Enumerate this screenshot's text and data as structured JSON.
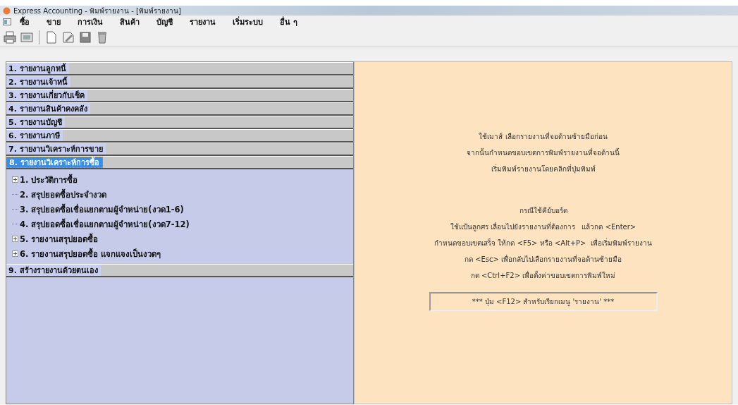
{
  "window": {
    "title": "Express Accounting - พิมพ์รายงาน - [พิมพ์รายงาน]"
  },
  "menu": [
    "ซื้อ",
    "ขาย",
    "การเงิน",
    "สินค้า",
    "บัญชี",
    "รายงาน",
    "เริ่มระบบ",
    "อื่น ๆ"
  ],
  "toolbar": [
    {
      "kind": "printer"
    },
    {
      "kind": "preview"
    },
    {
      "kind": "sep"
    },
    {
      "kind": "page"
    },
    {
      "kind": "edit"
    },
    {
      "kind": "save"
    },
    {
      "kind": "trash"
    }
  ],
  "categories": [
    {
      "label": "1. รายงานลูกหนี้",
      "selected": false
    },
    {
      "label": "2. รายงานเจ้าหนี้",
      "selected": false
    },
    {
      "label": "3. รายงานเกี่ยวกับเช็ค",
      "selected": false
    },
    {
      "label": "4. รายงานสินค้าคงคลัง",
      "selected": false
    },
    {
      "label": "5. รายงานบัญชี",
      "selected": false
    },
    {
      "label": "6. รายงานภาษี",
      "selected": false
    },
    {
      "label": "7. รายงานวิเคราะห์การขาย",
      "selected": false
    },
    {
      "label": "8. รายงานวิเคราะห์การซื้อ",
      "selected": true,
      "children": [
        {
          "label": "1. ประวัติการซื้อ",
          "expandable": true
        },
        {
          "label": "2. สรุปยอดซื้อประจำงวด",
          "expandable": false
        },
        {
          "label": "3. สรุปยอดซื้อเชื่อแยกตามผู้จำหน่าย(งวด1-6)",
          "expandable": false
        },
        {
          "label": "4. สรุปยอดซื้อเชื่อแยกตามผู้จำหน่าย(งวด7-12)",
          "expandable": false
        },
        {
          "label": "5. รายงานสรุปยอดซื้อ",
          "expandable": true
        },
        {
          "label": "6. รายงานสรุปยอดซื้อ แจกแจงเป็นงวดๆ",
          "expandable": true
        }
      ]
    },
    {
      "label": "9. สร้างรายงานด้วยตนเอง",
      "selected": false
    }
  ],
  "instructions": {
    "mouse": [
      "ใช้เมาส์ เลือกรายงานที่จอด้านซ้ายมือก่อน",
      "จากนั้นกำหนดขอบเขตการพิมพ์รายงานที่จอด้านนี้",
      "เริ่มพิมพ์รายงานโดยคลิกที่ปุ่มพิมพ์"
    ],
    "keyboard_title": "กรณีใช้คีย์บอร์ด",
    "keyboard": [
      "ใช้แป้นลูกศร เลื่อนไปยังรายงานที่ต้องการ   แล้วกด <Enter>",
      "กำหนดขอบเขตเสร็จ ให้กด <F5> หรือ <Alt+P>  เพื่อเริ่มพิมพ์รายงาน",
      "กด <Esc> เพื่อกลับไปเลือกรายงานที่จอด้านซ้ายมือ",
      "กด <Ctrl+F2> เพื่อตั้งค่าขอบเขตการพิมพ์ใหม่"
    ],
    "hint": "*** ปุ่ม <F12> สำหรับเรียกเมนู 'รายงาน' ***"
  }
}
